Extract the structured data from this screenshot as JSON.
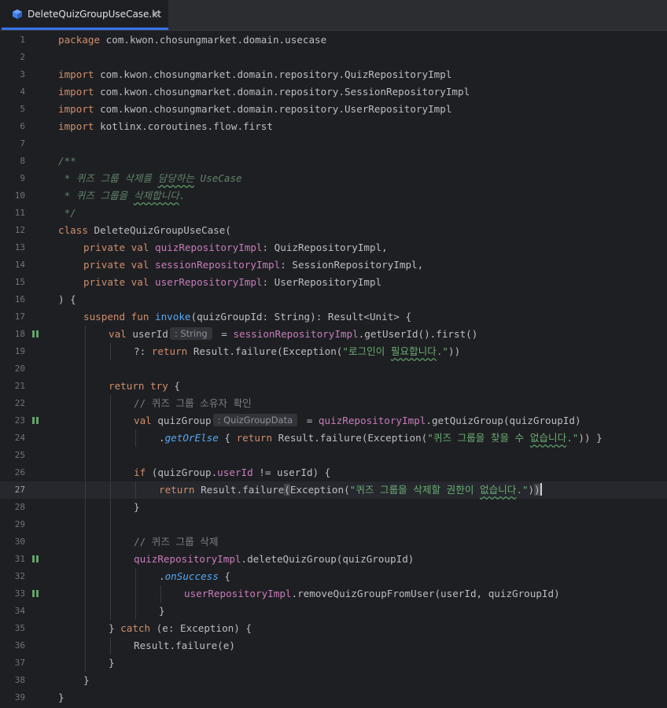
{
  "tab": {
    "title": "DeleteQuizGroupUseCase.kt",
    "close": "×",
    "icon": "kotlin-file-icon"
  },
  "editor": {
    "current_line": 27,
    "breakpoint_lines": [
      18,
      23,
      31,
      33
    ],
    "lines": [
      {
        "n": 1,
        "indent": 0,
        "spans": [
          [
            "package",
            "kw"
          ],
          [
            " com.kwon.chosungmarket.domain.usecase",
            ""
          ]
        ]
      },
      {
        "n": 2,
        "indent": 0,
        "spans": []
      },
      {
        "n": 3,
        "indent": 0,
        "spans": [
          [
            "import",
            "kw"
          ],
          [
            " com.kwon.chosungmarket.domain.repository.QuizRepositoryImpl",
            ""
          ]
        ]
      },
      {
        "n": 4,
        "indent": 0,
        "spans": [
          [
            "import",
            "kw"
          ],
          [
            " com.kwon.chosungmarket.domain.repository.SessionRepositoryImpl",
            ""
          ]
        ]
      },
      {
        "n": 5,
        "indent": 0,
        "spans": [
          [
            "import",
            "kw"
          ],
          [
            " com.kwon.chosungmarket.domain.repository.UserRepositoryImpl",
            ""
          ]
        ]
      },
      {
        "n": 6,
        "indent": 0,
        "spans": [
          [
            "import",
            "kw"
          ],
          [
            " kotlinx.coroutines.flow.first",
            ""
          ]
        ]
      },
      {
        "n": 7,
        "indent": 0,
        "spans": []
      },
      {
        "n": 8,
        "indent": 0,
        "spans": [
          [
            "/**",
            "doc"
          ]
        ]
      },
      {
        "n": 9,
        "indent": 0,
        "spans": [
          [
            " * 퀴즈 그룹 삭제를 ",
            "doc"
          ],
          [
            "담당하는",
            "doc squig"
          ],
          [
            " UseCase",
            "doc"
          ]
        ]
      },
      {
        "n": 10,
        "indent": 0,
        "spans": [
          [
            " * 퀴즈 그룹을 ",
            "doc"
          ],
          [
            "삭제합니다",
            "doc squig"
          ],
          [
            ".",
            "doc"
          ]
        ]
      },
      {
        "n": 11,
        "indent": 0,
        "spans": [
          [
            " */",
            "doc"
          ]
        ]
      },
      {
        "n": 12,
        "indent": 0,
        "spans": [
          [
            "class",
            "kw"
          ],
          [
            " DeleteQuizGroupUseCase(",
            ""
          ]
        ]
      },
      {
        "n": 13,
        "indent": 1,
        "spans": [
          [
            "private val",
            "kw"
          ],
          [
            " ",
            ""
          ],
          [
            "quizRepositoryImpl",
            "prop"
          ],
          [
            ": QuizRepositoryImpl,",
            ""
          ]
        ]
      },
      {
        "n": 14,
        "indent": 1,
        "spans": [
          [
            "private val",
            "kw"
          ],
          [
            " ",
            ""
          ],
          [
            "sessionRepositoryImpl",
            "prop"
          ],
          [
            ": SessionRepositoryImpl,",
            ""
          ]
        ]
      },
      {
        "n": 15,
        "indent": 1,
        "spans": [
          [
            "private val",
            "kw"
          ],
          [
            " ",
            ""
          ],
          [
            "userRepositoryImpl",
            "prop"
          ],
          [
            ": UserRepositoryImpl",
            ""
          ]
        ]
      },
      {
        "n": 16,
        "indent": 0,
        "spans": [
          [
            ") {",
            ""
          ]
        ]
      },
      {
        "n": 17,
        "indent": 1,
        "spans": [
          [
            "suspend fun",
            "kw"
          ],
          [
            " ",
            ""
          ],
          [
            "invoke",
            "fn"
          ],
          [
            "(quizGroupId: String): Result<Unit> {",
            ""
          ]
        ]
      },
      {
        "n": 18,
        "indent": 2,
        "spans": [
          [
            "val",
            "kw"
          ],
          [
            " userId",
            ""
          ],
          [
            ": String",
            "hint"
          ],
          [
            " = ",
            ""
          ],
          [
            "sessionRepositoryImpl",
            "prop"
          ],
          [
            ".getUserId().first()",
            ""
          ]
        ]
      },
      {
        "n": 19,
        "indent": 3,
        "spans": [
          [
            "?: ",
            ""
          ],
          [
            "return",
            "kw"
          ],
          [
            " Result.failure(Exception(",
            ""
          ],
          [
            "\"로그인이 ",
            "str"
          ],
          [
            "필요합니다",
            "str squig"
          ],
          [
            ".\"",
            "str"
          ],
          [
            "))",
            ""
          ]
        ]
      },
      {
        "n": 20,
        "indent": 0,
        "spans": []
      },
      {
        "n": 21,
        "indent": 2,
        "spans": [
          [
            "return try",
            "kw"
          ],
          [
            " {",
            ""
          ]
        ]
      },
      {
        "n": 22,
        "indent": 3,
        "spans": [
          [
            "// 퀴즈 그룹 소유자 확인",
            "cm"
          ]
        ]
      },
      {
        "n": 23,
        "indent": 3,
        "spans": [
          [
            "val",
            "kw"
          ],
          [
            " quizGroup",
            ""
          ],
          [
            ": QuizGroupData",
            "hint"
          ],
          [
            " = ",
            ""
          ],
          [
            "quizRepositoryImpl",
            "prop"
          ],
          [
            ".getQuizGroup(quizGroupId)",
            ""
          ]
        ]
      },
      {
        "n": 24,
        "indent": 4,
        "spans": [
          [
            ".",
            ""
          ],
          [
            "getOrElse",
            "ext"
          ],
          [
            " { ",
            ""
          ],
          [
            "return",
            "kw"
          ],
          [
            " Result.failure(Exception(",
            ""
          ],
          [
            "\"퀴즈 그룹을 찾을 수 ",
            "str"
          ],
          [
            "없습니다",
            "str squig"
          ],
          [
            ".\"",
            "str"
          ],
          [
            ")) }",
            ""
          ]
        ]
      },
      {
        "n": 25,
        "indent": 0,
        "spans": []
      },
      {
        "n": 26,
        "indent": 3,
        "spans": [
          [
            "if",
            "kw"
          ],
          [
            " (quizGroup.",
            ""
          ],
          [
            "userId",
            "prop"
          ],
          [
            " != userId) {",
            ""
          ]
        ]
      },
      {
        "n": 27,
        "indent": 4,
        "spans": [
          [
            "return",
            "kw"
          ],
          [
            " Result.failure",
            ""
          ],
          [
            "(",
            "bracket"
          ],
          [
            "Exception(",
            ""
          ],
          [
            "\"퀴즈 그룹을 삭제할 권한이 ",
            "str"
          ],
          [
            "없습니다",
            "str squig"
          ],
          [
            ".\"",
            "str"
          ],
          [
            ")",
            ""
          ],
          [
            ")",
            "bracket"
          ],
          [
            "",
            "cursor"
          ]
        ]
      },
      {
        "n": 28,
        "indent": 3,
        "spans": [
          [
            "}",
            ""
          ]
        ]
      },
      {
        "n": 29,
        "indent": 0,
        "spans": []
      },
      {
        "n": 30,
        "indent": 3,
        "spans": [
          [
            "// 퀴즈 그룹 삭제",
            "cm"
          ]
        ]
      },
      {
        "n": 31,
        "indent": 3,
        "spans": [
          [
            "quizRepositoryImpl",
            "prop"
          ],
          [
            ".deleteQuizGroup(quizGroupId)",
            ""
          ]
        ]
      },
      {
        "n": 32,
        "indent": 4,
        "spans": [
          [
            ".",
            ""
          ],
          [
            "onSuccess",
            "ext"
          ],
          [
            " {",
            ""
          ]
        ]
      },
      {
        "n": 33,
        "indent": 5,
        "spans": [
          [
            "userRepositoryImpl",
            "prop"
          ],
          [
            ".removeQuizGroupFromUser(userId, quizGroupId)",
            ""
          ]
        ]
      },
      {
        "n": 34,
        "indent": 4,
        "spans": [
          [
            "}",
            ""
          ]
        ]
      },
      {
        "n": 35,
        "indent": 2,
        "spans": [
          [
            "} ",
            ""
          ],
          [
            "catch",
            "kw"
          ],
          [
            " (e: Exception) {",
            ""
          ]
        ]
      },
      {
        "n": 36,
        "indent": 3,
        "spans": [
          [
            "Result.failure(e)",
            ""
          ]
        ]
      },
      {
        "n": 37,
        "indent": 2,
        "spans": [
          [
            "}",
            ""
          ]
        ]
      },
      {
        "n": 38,
        "indent": 1,
        "spans": [
          [
            "}",
            ""
          ]
        ]
      },
      {
        "n": 39,
        "indent": 0,
        "spans": [
          [
            "}",
            ""
          ]
        ]
      }
    ]
  }
}
